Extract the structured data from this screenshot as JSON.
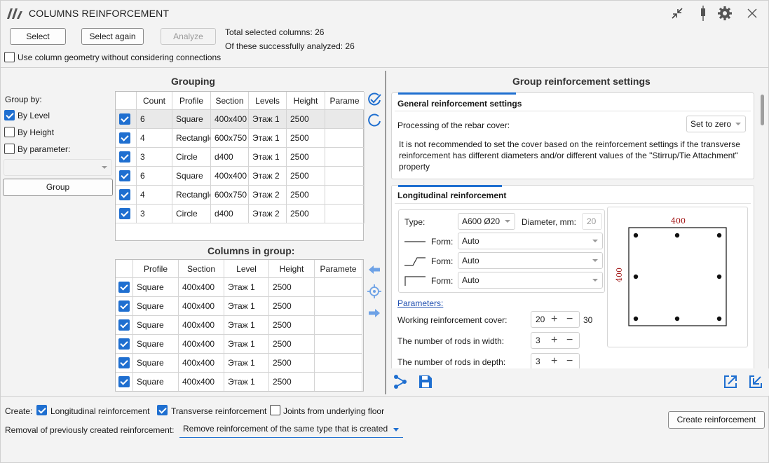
{
  "window": {
    "title": "COLUMNS REINFORCEMENT"
  },
  "toolbar": {
    "select_label": "Select",
    "select_again_label": "Select again",
    "analyze_label": "Analyze",
    "total_selected": "Total selected columns: 26",
    "successfully_analyzed": "Of these successfully analyzed: 26",
    "use_geometry_label": "Use column geometry without considering connections"
  },
  "grouping": {
    "title": "Grouping",
    "group_by_label": "Group by:",
    "by_level": "By Level",
    "by_height": "By Height",
    "by_parameter": "By parameter:",
    "group_button": "Group",
    "headers": [
      "Count",
      "Profile",
      "Section",
      "Levels",
      "Height",
      "Parame"
    ],
    "rows": [
      {
        "count": "6",
        "profile": "Square",
        "section": "400x400",
        "levels": "Этаж 1",
        "height": "2500"
      },
      {
        "count": "4",
        "profile": "Rectangle",
        "section": "600x750",
        "levels": "Этаж 1",
        "height": "2500"
      },
      {
        "count": "3",
        "profile": "Circle",
        "section": "d400",
        "levels": "Этаж 1",
        "height": "2500"
      },
      {
        "count": "6",
        "profile": "Square",
        "section": "400x400",
        "levels": "Этаж 2",
        "height": "2500"
      },
      {
        "count": "4",
        "profile": "Rectangle",
        "section": "600x750",
        "levels": "Этаж 2",
        "height": "2500"
      },
      {
        "count": "3",
        "profile": "Circle",
        "section": "d400",
        "levels": "Этаж 2",
        "height": "2500"
      }
    ]
  },
  "columns_in_group": {
    "title": "Columns in group:",
    "headers": [
      "Profile",
      "Section",
      "Level",
      "Height",
      "Paramete"
    ],
    "rows": [
      {
        "profile": "Square",
        "section": "400x400",
        "level": "Этаж 1",
        "height": "2500"
      },
      {
        "profile": "Square",
        "section": "400x400",
        "level": "Этаж 1",
        "height": "2500"
      },
      {
        "profile": "Square",
        "section": "400x400",
        "level": "Этаж 1",
        "height": "2500"
      },
      {
        "profile": "Square",
        "section": "400x400",
        "level": "Этаж 1",
        "height": "2500"
      },
      {
        "profile": "Square",
        "section": "400x400",
        "level": "Этаж 1",
        "height": "2500"
      },
      {
        "profile": "Square",
        "section": "400x400",
        "level": "Этаж 1",
        "height": "2500"
      }
    ]
  },
  "settings": {
    "title": "Group reinforcement settings",
    "general": {
      "title": "General reinforcement settings",
      "cover_label": "Processing of the rebar cover:",
      "cover_value": "Set to zero",
      "note": "It is not recommended to set the cover based on the reinforcement settings if the transverse reinforcement has different diameters and/or different values of the \"Stirrup/Tie Attachment\" property"
    },
    "longitudinal": {
      "title": "Longitudinal reinforcement",
      "type_label": "Type:",
      "type_value": "A600 Ø20",
      "diameter_label": "Diameter, mm:",
      "diameter_value": "20",
      "form_label": "Form:",
      "form1": "Auto",
      "form2": "Auto",
      "form3": "Auto",
      "parameters_link": "Parameters:",
      "cover_label": "Working reinforcement cover:",
      "cover_value": "20",
      "cover_extra": "30",
      "rods_width_label": "The number of rods in width:",
      "rods_width_value": "3",
      "rods_depth_label": "The number of rods in depth:",
      "rods_depth_value": "3",
      "section_width": "400",
      "section_depth": "400"
    }
  },
  "bottom": {
    "create_label": "Create:",
    "longitudinal": "Longitudinal reinforcement",
    "transverse": "Transverse reinforcement",
    "joints": "Joints from underlying floor",
    "removal_label": "Removal of previously created reinforcement:",
    "removal_value": "Remove reinforcement of the same type that is created",
    "create_button": "Create reinforcement"
  },
  "colors": {
    "accent": "#1f6fd0",
    "dim_red": "#a01010"
  }
}
